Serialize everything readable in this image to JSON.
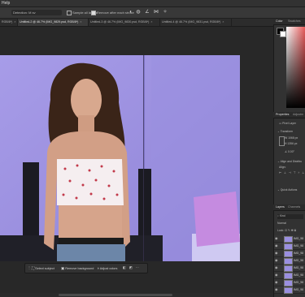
{
  "menubar": {
    "help": "Help"
  },
  "options": {
    "tolerance_label": "Detection: M sv",
    "sample_all_layers": "Sample all layers",
    "remove_after": "Remove after each stroke"
  },
  "tabs": [
    {
      "label": "RGB/8*)",
      "active": false
    },
    {
      "label": "Untitled-2 @ 46.7% (IMG_9829.psd, RGB/8*)",
      "active": true
    },
    {
      "label": "Untitled-3 @ 46.7% (IMG_9830.psd, RGB/8*)",
      "active": false
    },
    {
      "label": "Untitled-4 @ 46.7% (IMG_9831.psd, RGB/8*)",
      "active": false
    }
  ],
  "contextual_bar": {
    "select_subject": "Select subject",
    "remove_background": "Remove background",
    "adjust_colors": "Adjust colors"
  },
  "panels": {
    "color_tab": "Color",
    "swatches_tab": "Swatches",
    "properties_tab": "Properties",
    "adjustments_tab": "Adjustm",
    "pixel_layer": "Pixel Layer",
    "transform": "Transform",
    "w_value": "1068 px",
    "h_value": "1356 px",
    "angle": "0.00°",
    "align_title": "Align and Distribu",
    "align_label": "Align:",
    "quick_actions": "Quick Actions",
    "layers_tab": "Layers",
    "channels_tab": "Channels",
    "kind": "Kind",
    "blend": "Normal",
    "lock": "Lock:",
    "layers": [
      {
        "name": "IMG_98"
      },
      {
        "name": "IMG_98"
      },
      {
        "name": "IMG_98"
      },
      {
        "name": "IMG_98"
      },
      {
        "name": "IMG_98"
      },
      {
        "name": "IMG_98"
      },
      {
        "name": "IMG_98"
      },
      {
        "name": "IMG_98"
      }
    ]
  },
  "colors": {
    "workspace": "#282828",
    "wall": "#9d92e0",
    "pillow": "#c58be0",
    "accent": "#2680eb"
  }
}
